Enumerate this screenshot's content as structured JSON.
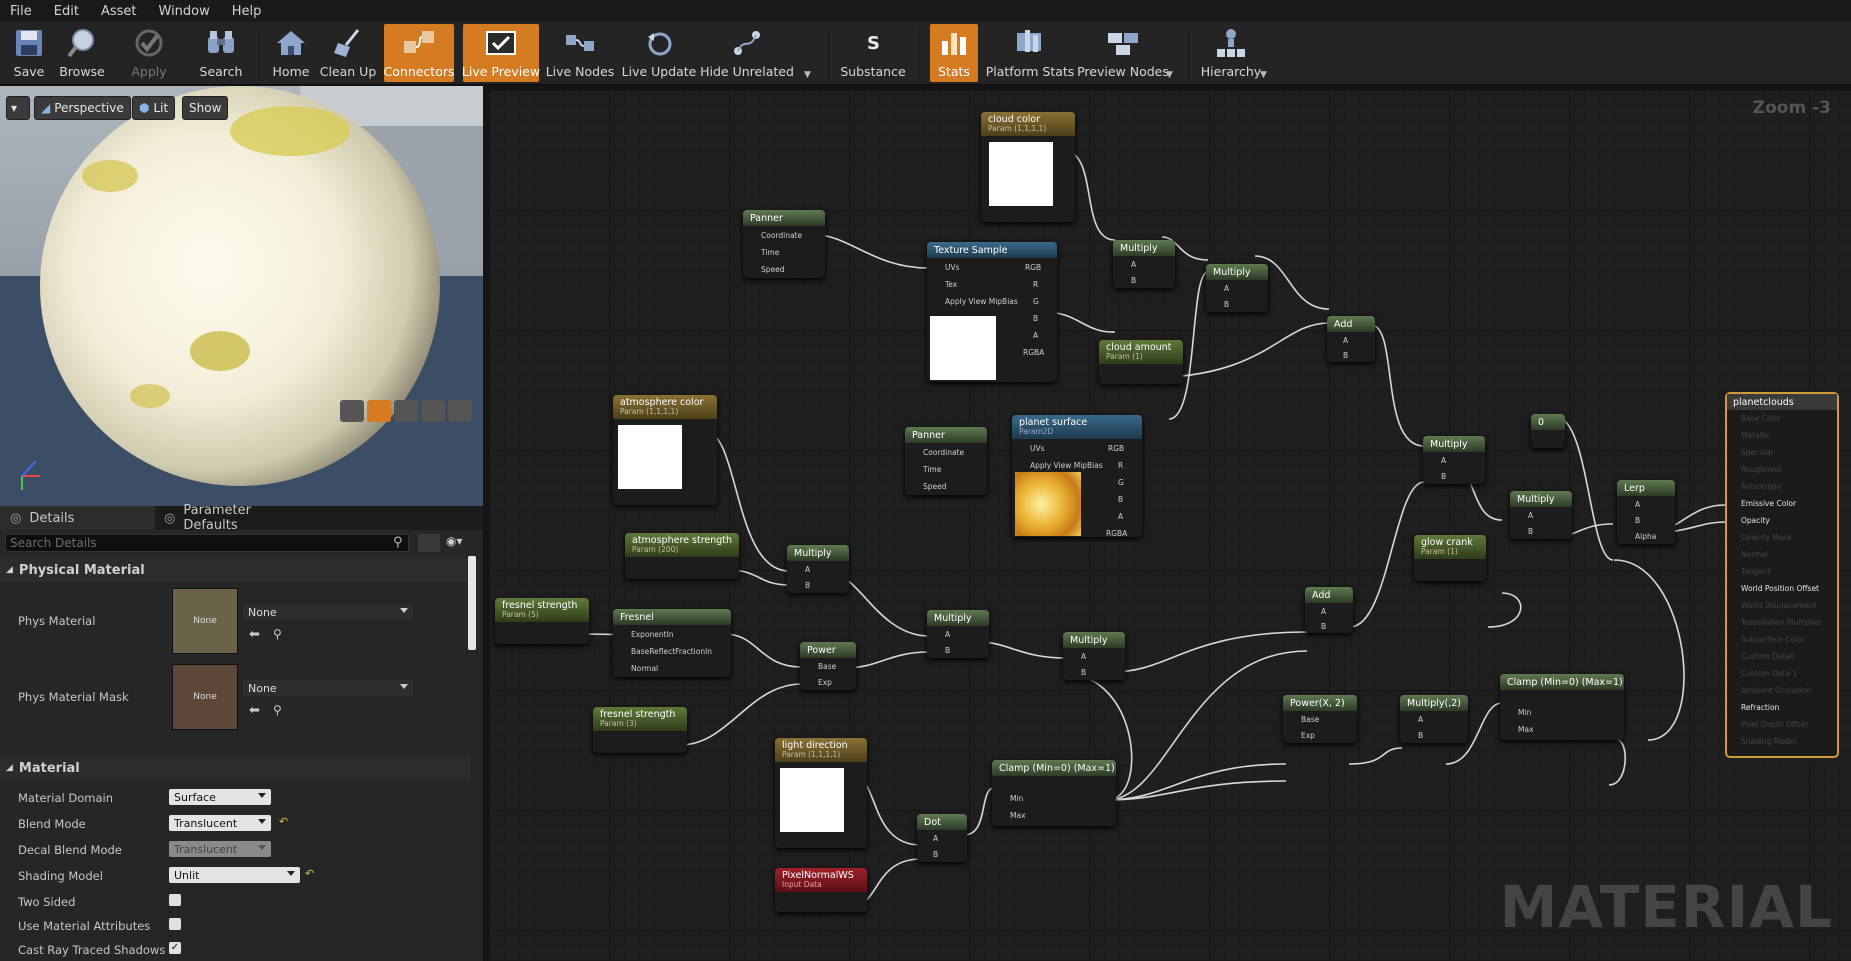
{
  "menu": [
    "File",
    "Edit",
    "Asset",
    "Window",
    "Help"
  ],
  "toolbar": {
    "save": "Save",
    "browse": "Browse",
    "apply": "Apply",
    "search": "Search",
    "home": "Home",
    "cleanup": "Clean Up",
    "connectors": "Connectors",
    "live_preview": "Live Preview",
    "live_nodes": "Live Nodes",
    "live_update": "Live Update",
    "hide_unrelated": "Hide Unrelated",
    "substance": "Substance",
    "stats": "Stats",
    "platform_stats": "Platform Stats",
    "preview_nodes": "Preview Nodes",
    "hierarchy": "Hierarchy"
  },
  "viewport": {
    "perspective": "Perspective",
    "lit": "Lit",
    "show": "Show"
  },
  "details": {
    "tab_details": "Details",
    "tab_params": "Parameter Defaults",
    "search_placeholder": "Search Details",
    "cat_physical": "Physical Material",
    "cat_material": "Material",
    "phys_material": "Phys Material",
    "phys_material_mask": "Phys Material Mask",
    "thumb_none": "None",
    "combo_none": "None",
    "material_domain": "Material Domain",
    "material_domain_val": "Surface",
    "blend_mode": "Blend Mode",
    "blend_mode_val": "Translucent",
    "decal_blend_mode": "Decal Blend Mode",
    "decal_blend_mode_val": "Translucent",
    "shading_model": "Shading Model",
    "shading_model_val": "Unlit",
    "two_sided": "Two Sided",
    "use_material_attributes": "Use Material Attributes",
    "cast_ray": "Cast Ray Traced Shadows"
  },
  "graph": {
    "zoom": "Zoom -3",
    "watermark": "MATERIAL",
    "nodes": {
      "cloud_color": "cloud color",
      "param_1111": "Param (1,1,1,1)",
      "panner1": "Panner",
      "coordinate": "Coordinate",
      "time": "Time",
      "speed": "Speed",
      "texture_sample": "Texture Sample",
      "uvs": "UVs",
      "tex": "Tex",
      "apply_mip": "Apply View MipBias",
      "rgb": "RGB",
      "r": "R",
      "g": "G",
      "b": "B",
      "a": "A",
      "rgba": "RGBA",
      "multiply": "Multiply",
      "pin_a": "A",
      "pin_b": "B",
      "cloud_amount": "cloud amount",
      "param_1": "Param (1)",
      "add": "Add",
      "atmosphere_color": "atmosphere color",
      "atmosphere_strength": "atmosphere strength",
      "param_200": "Param (200)",
      "panner2": "Panner",
      "planet_surface": "planet surface",
      "param2d": "Param2D",
      "fresnel_strength": "fresnel strength",
      "param_5": "Param (5)",
      "fresnel": "Fresnel",
      "exponentin": "ExponentIn",
      "basereflect": "BaseReflectFractionIn",
      "normal": "Normal",
      "power": "Power",
      "base": "Base",
      "exp": "Exp",
      "fresnel_strength2": "fresnel strength",
      "param_3": "Param (3)",
      "light_direction": "light direction",
      "pixelnormal": "PixelNormalWS",
      "input_data": "Input Data",
      "dot": "Dot",
      "clamp1": "Clamp (Min=0) (Max=1)",
      "min": "Min",
      "max": "Max",
      "powerx2": "Power(X, 2)",
      "multiply2": "Multiply(,2)",
      "clamp2": "Clamp (Min=0) (Max=1)",
      "glow_crank": "glow crank",
      "const0": "0",
      "lerp": "Lerp",
      "alpha": "Alpha"
    },
    "result": {
      "title": "planetclouds",
      "inputs": [
        "Base Color",
        "Metallic",
        "Specular",
        "Roughness",
        "Anisotropy",
        "Emissive Color",
        "Opacity",
        "Opacity Mask",
        "Normal",
        "Tangent",
        "World Position Offset",
        "World Displacement",
        "Tessellation Multiplier",
        "Subsurface Color",
        "Custom Data0",
        "Custom Data 1",
        "Ambient Occlusion",
        "Refraction",
        "Pixel Depth Offset",
        "Shading Model"
      ]
    }
  },
  "colors": {
    "accent": "#d57b22",
    "node_header_green": "#5f7a52",
    "result_border": "#d39a3a"
  }
}
